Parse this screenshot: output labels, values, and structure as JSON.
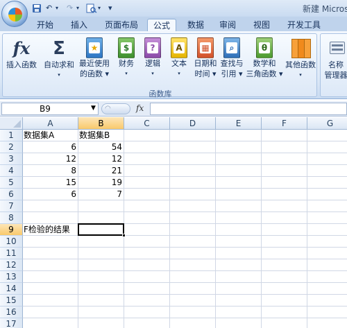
{
  "titlebar": {
    "title": "新建 Microso",
    "qa_undo": "↶",
    "qa_redo": "↷",
    "qa_custom": "▾"
  },
  "tabs": [
    {
      "label": "开始",
      "active": false
    },
    {
      "label": "插入",
      "active": false
    },
    {
      "label": "页面布局",
      "active": false
    },
    {
      "label": "公式",
      "active": true
    },
    {
      "label": "数据",
      "active": false
    },
    {
      "label": "审阅",
      "active": false
    },
    {
      "label": "视图",
      "active": false
    },
    {
      "label": "开发工具",
      "active": false
    }
  ],
  "ribbon": {
    "group_label": "函数库",
    "buttons": [
      {
        "line1": "插入函数",
        "line2": "",
        "icon": "fx-icon"
      },
      {
        "line1": "自动求和",
        "line2": "▾",
        "icon": "sigma-icon"
      },
      {
        "line1": "最近使用",
        "line2": "的函数 ▾",
        "icon": "star-book-icon"
      },
      {
        "line1": "财务",
        "line2": "▾",
        "icon": "finance-book-icon"
      },
      {
        "line1": "逻辑",
        "line2": "▾",
        "icon": "logic-book-icon"
      },
      {
        "line1": "文本",
        "line2": "▾",
        "icon": "text-book-icon"
      },
      {
        "line1": "日期和",
        "line2": "时间 ▾",
        "icon": "date-book-icon"
      },
      {
        "line1": "查找与",
        "line2": "引用 ▾",
        "icon": "lookup-book-icon"
      },
      {
        "line1": "数学和",
        "line2": "三角函数 ▾",
        "icon": "math-book-icon"
      },
      {
        "line1": "其他函数",
        "line2": "▾",
        "icon": "more-books-icon"
      }
    ],
    "name_manager": {
      "line1": "名称",
      "line2": "管理器"
    }
  },
  "formula_bar": {
    "name_box": "B9",
    "fx_label": "fx",
    "formula": ""
  },
  "columns": [
    "A",
    "B",
    "C",
    "D",
    "E",
    "F",
    "G"
  ],
  "selected_column": "B",
  "rows": [
    "1",
    "2",
    "3",
    "4",
    "5",
    "6",
    "7",
    "8",
    "9",
    "10",
    "11",
    "12",
    "13",
    "14",
    "15",
    "16",
    "17"
  ],
  "selected_row": "9",
  "cells": {
    "A1": "数据集A",
    "B1": "数据集B",
    "A2": "6",
    "B2": "54",
    "A3": "12",
    "B3": "12",
    "A4": "8",
    "B4": "21",
    "A5": "15",
    "B5": "19",
    "A6": "6",
    "B6": "7",
    "A9": "F检验的结果"
  },
  "active_cell": "B9"
}
